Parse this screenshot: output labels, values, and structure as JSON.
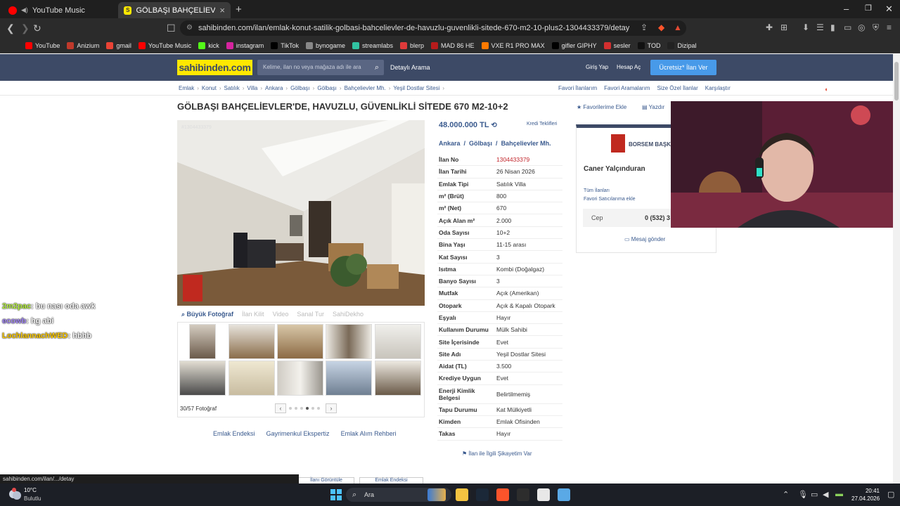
{
  "browser": {
    "tabs": [
      {
        "title": "YouTube Music",
        "active": false,
        "color": "#ff0000"
      },
      {
        "title": "GÖLBAŞI BAHÇELİEVLER'DE, HA...",
        "active": true,
        "color": "#ffe800"
      }
    ],
    "new_tab": "+",
    "url": "sahibinden.com/ilan/emlak-konut-satilik-golbasi-bahcelievler-de-havuzlu-guvenlikli-sitede-670-m2-10-plus2-1304433379/detay",
    "bookmarks": [
      {
        "label": "YouTube",
        "color": "#ff0000"
      },
      {
        "label": "Anizium",
        "color": "#c0392b"
      },
      {
        "label": "gmail",
        "color": "#ea4335"
      },
      {
        "label": "YouTube Music",
        "color": "#ff0000"
      },
      {
        "label": "kick",
        "color": "#53fc18"
      },
      {
        "label": "instagram",
        "color": "#d6249f"
      },
      {
        "label": "TikTok",
        "color": "#000000"
      },
      {
        "label": "bynogame",
        "color": "#888888"
      },
      {
        "label": "streamlabs",
        "color": "#31c3a2"
      },
      {
        "label": "blerp",
        "color": "#e03a3a"
      },
      {
        "label": "MAD 86 HE",
        "color": "#b71c1c"
      },
      {
        "label": "VXE R1 PRO MAX",
        "color": "#ff7a00"
      },
      {
        "label": "gifler GIPHY",
        "color": "#000000"
      },
      {
        "label": "sesler",
        "color": "#d32f2f"
      },
      {
        "label": "TOD",
        "color": "#111111"
      },
      {
        "label": "Dizipal",
        "color": "#222222"
      }
    ]
  },
  "site": {
    "logo": "sahibinden.com",
    "search_placeholder": "Kelime, ilan no veya mağaza adı ile ara",
    "detailed_search": "Detaylı Arama",
    "login": "Giriş Yap",
    "signup": "Hesap Aç",
    "post_ad": "Ücretsiz* İlan Ver",
    "breadcrumb": [
      "Emlak",
      "Konut",
      "Satılık",
      "Villa",
      "Ankara",
      "Gölbaşı",
      "Gölbaşı",
      "Bahçelievler Mh.",
      "Yeşil Dostlar Sitesi"
    ],
    "top_links": [
      "Favori İlanlarım",
      "Favori Aramalarım",
      "Size Özel İlanlar",
      "Karşılaştır"
    ]
  },
  "listing": {
    "title": "GÖLBAŞI BAHÇELİEVLER'DE, HAVUZLU, GÜVENLİKLİ SİTEDE 670 M2-10+2",
    "add_favorite": "Favorilerime Ekle",
    "print": "Yazdır",
    "photo_id": "#1304433379",
    "photo_tools": [
      "Büyük Fotoğraf",
      "İlan Kilit",
      "Video",
      "Sanal Tur",
      "SahiDekho"
    ],
    "photo_count": "30/57 Fotoğraf",
    "price": "48.000.000 TL",
    "credit_offers": "Kredi Teklifleri",
    "location": [
      "Ankara",
      "/",
      "Gölbaşı",
      "/",
      "Bahçelievler Mh."
    ],
    "details": [
      {
        "k": "İlan No",
        "v": "1304433379",
        "red": true
      },
      {
        "k": "İlan Tarihi",
        "v": "26 Nisan 2026"
      },
      {
        "k": "Emlak Tipi",
        "v": "Satılık Villa"
      },
      {
        "k": "m² (Brüt)",
        "v": "800"
      },
      {
        "k": "m² (Net)",
        "v": "670"
      },
      {
        "k": "Açık Alan m²",
        "v": "2.000"
      },
      {
        "k": "Oda Sayısı",
        "v": "10+2"
      },
      {
        "k": "Bina Yaşı",
        "v": "11-15 arası"
      },
      {
        "k": "Kat Sayısı",
        "v": "3"
      },
      {
        "k": "Isıtma",
        "v": "Kombi (Doğalgaz)"
      },
      {
        "k": "Banyo Sayısı",
        "v": "3"
      },
      {
        "k": "Mutfak",
        "v": "Açık (Amerikan)"
      },
      {
        "k": "Otopark",
        "v": "Açık & Kapalı Otopark"
      },
      {
        "k": "Eşyalı",
        "v": "Hayır"
      },
      {
        "k": "Kullanım Durumu",
        "v": "Mülk Sahibi"
      },
      {
        "k": "Site İçerisinde",
        "v": "Evet"
      },
      {
        "k": "Site Adı",
        "v": "Yeşil Dostlar Sitesi"
      },
      {
        "k": "Aidat (TL)",
        "v": "3.500"
      },
      {
        "k": "Krediye Uygun",
        "v": "Evet"
      },
      {
        "k": "Enerji Kimlik Belgesi",
        "v": "Belirtilmemiş",
        "tall": true
      },
      {
        "k": "Tapu Durumu",
        "v": "Kat Mülkiyetli"
      },
      {
        "k": "Kimden",
        "v": "Emlak Ofisinden"
      },
      {
        "k": "Takas",
        "v": "Hayır"
      }
    ],
    "complaint": "İlan ile İlgili Şikayetim Var",
    "bottom_links": [
      "Emlak Endeksi",
      "Gayrimenkul Ekspertiz",
      "Emlak Alım Rehberi"
    ],
    "bottom_buttons": [
      "İlanı Görüntüle",
      "Emlak Endeksi"
    ]
  },
  "seller": {
    "company": "BORSEM BAŞKENT",
    "name": "Caner Yalçınduran",
    "all_ads": "Tüm İlanları",
    "fav_seller": "Favori Satıcılarıma ekle",
    "phone_label": "Cep",
    "phone": "0 (532) 3",
    "message": "Mesaj gönder"
  },
  "chat": [
    {
      "user": "2m2pac",
      "text": ": bu nası oda awk",
      "color": "#b9f542"
    },
    {
      "user": "ecowb",
      "text": ": hg abi",
      "color": "#a78bfa"
    },
    {
      "user": "LochlannachWED",
      "text": ": hbhb",
      "color": "#ffcc00"
    }
  ],
  "status_url": "sahibinden.com/ilan/.../detay",
  "taskbar": {
    "temp": "10°C",
    "condition": "Bulutlu",
    "search": "Ara",
    "time": "20:41",
    "date": "27.04.2026"
  }
}
